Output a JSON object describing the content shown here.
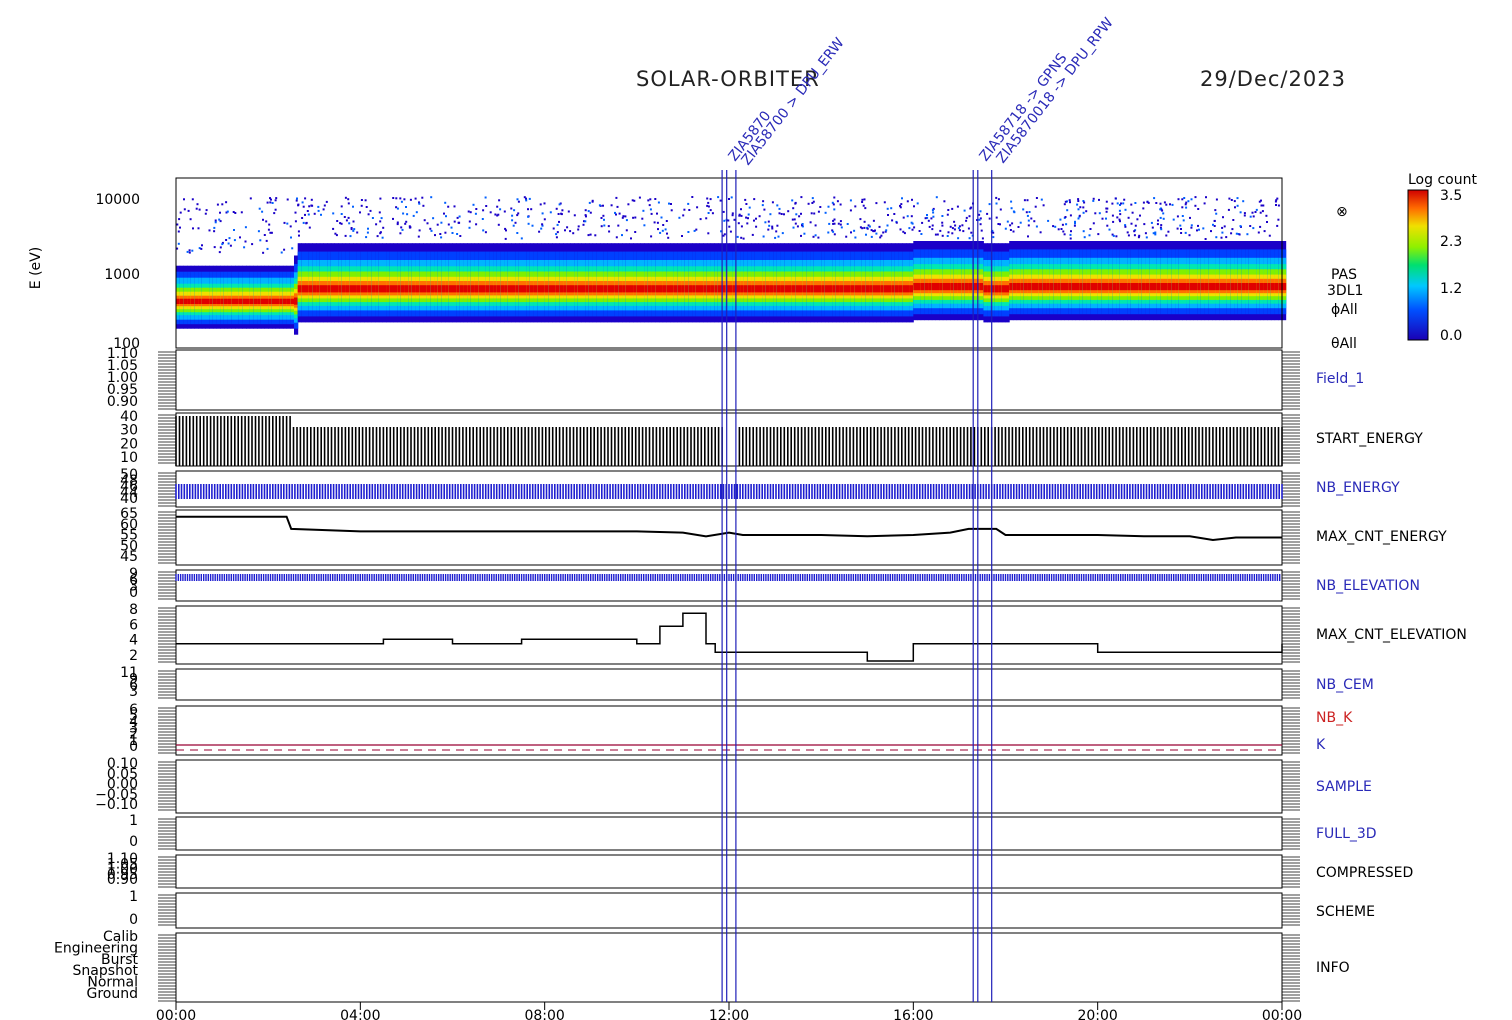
{
  "title": "SOLAR-ORBITER",
  "date": "29/Dec/2023",
  "colorbar": {
    "title": "Log count",
    "ticks": [
      "3.5",
      "2.3",
      "1.2",
      "0.0"
    ]
  },
  "spectrogram": {
    "ylabel": "E (eV)",
    "yticks": [
      "10000",
      "1000",
      "100"
    ],
    "labels": [
      "PAS",
      "3DL1",
      "ϕAll",
      "θAll"
    ],
    "symbol": "⊗"
  },
  "x_ticks": [
    "00:00",
    "04:00",
    "08:00",
    "12:00",
    "16:00",
    "20:00",
    "00:00"
  ],
  "event_labels": [
    "ZIA5870",
    "ZIA58700 > DPU_ERW",
    "ZIA58718 -> GPNS",
    "ZIA5870018 -> DPU_RPW"
  ],
  "colors": {
    "blue_line": "#1f1fb8",
    "blue_text": "#2a2ab8",
    "red_text": "#cc2222",
    "k_line": "#990033"
  },
  "panels": [
    {
      "name": "Field_1",
      "color": "blue",
      "ticks": [
        "1.10",
        "1.05",
        "1.00",
        "0.95",
        "0.90"
      ]
    },
    {
      "name": "START_ENERGY",
      "color": "black",
      "ticks": [
        "40",
        "30",
        "20",
        "10"
      ]
    },
    {
      "name": "NB_ENERGY",
      "color": "blue",
      "ticks": [
        "50",
        "48",
        "46",
        "44",
        "40"
      ]
    },
    {
      "name": "MAX_CNT_ENERGY",
      "color": "black",
      "ticks": [
        "65",
        "60",
        "55",
        "50",
        "45"
      ]
    },
    {
      "name": "NB_ELEVATION",
      "color": "blue",
      "ticks": [
        "9",
        "6",
        "3",
        "0"
      ]
    },
    {
      "name": "MAX_CNT_ELEVATION",
      "color": "black",
      "ticks": [
        "8",
        "6",
        "4",
        "2"
      ]
    },
    {
      "name": "NB_CEM",
      "color": "blue",
      "ticks": [
        "11",
        "9",
        "6",
        "3"
      ]
    },
    {
      "name": "NB_K",
      "name2": "K",
      "color": "red",
      "ticks": [
        "6",
        "5",
        "4",
        "3",
        "2",
        "1",
        "0"
      ]
    },
    {
      "name": "SAMPLE",
      "color": "blue",
      "ticks": [
        "0.10",
        "0.05",
        "0.00",
        "−0.05",
        "−0.10"
      ]
    },
    {
      "name": "FULL_3D",
      "color": "blue",
      "ticks": [
        "1",
        "0"
      ]
    },
    {
      "name": "COMPRESSED",
      "color": "black",
      "ticks": [
        "1.10",
        "1.05",
        "1.00",
        "0.95",
        "0.90"
      ]
    },
    {
      "name": "SCHEME",
      "color": "black",
      "ticks": [
        "1",
        "0"
      ]
    },
    {
      "name": "INFO",
      "color": "black",
      "ticks": [
        "Calib",
        "Engineering",
        "Burst",
        "Snapshot",
        "Normal",
        "Ground"
      ]
    }
  ],
  "chart_data": {
    "type": "line",
    "x_unit": "hours",
    "xlim": [
      0,
      24
    ],
    "event_times": [
      11.85,
      11.95,
      12.15,
      17.3,
      17.4,
      17.7
    ],
    "max_cnt_energy": {
      "x": [
        0,
        1,
        2,
        2.4,
        2.5,
        4,
        6,
        8,
        9,
        10,
        11,
        11.5,
        12,
        12.3,
        13,
        14,
        15,
        16,
        16.8,
        17.2,
        17.8,
        18,
        19,
        20,
        21,
        22,
        22.5,
        23,
        24
      ],
      "y": [
        63.5,
        63.5,
        63.5,
        63.5,
        58.5,
        57.5,
        57.5,
        57.5,
        57.5,
        57.5,
        57,
        55.5,
        57,
        56,
        56,
        56,
        55.5,
        56,
        57,
        58.5,
        58.5,
        56,
        56,
        56,
        55.5,
        55.5,
        54,
        55,
        55
      ]
    },
    "start_energy": {
      "x": [
        0,
        2.5,
        2.6,
        24
      ],
      "y": [
        40,
        40,
        33,
        33
      ]
    },
    "nb_energy": {
      "x": [
        0,
        24
      ],
      "y": [
        46,
        46
      ]
    },
    "nb_elevation": {
      "x": [
        0,
        24
      ],
      "y": [
        8,
        8
      ]
    },
    "max_cnt_elevation": {
      "x": [
        0,
        1.4,
        1.5,
        2.2,
        4.5,
        6,
        7.5,
        9,
        10,
        10.5,
        11,
        11.5,
        11.7,
        12,
        13,
        14,
        15,
        16,
        17,
        18,
        19,
        20,
        21,
        22,
        23,
        24
      ],
      "y": [
        4,
        4,
        4,
        4,
        4.5,
        4,
        4.5,
        4.5,
        4,
        6,
        7.5,
        4,
        3,
        3,
        3,
        3,
        2,
        4,
        4,
        4,
        4,
        3,
        3,
        3,
        3,
        4
      ]
    },
    "k_value": 1,
    "spectrogram_peak_energy_ev": {
      "x": [
        0,
        2.5,
        2.6,
        12,
        16,
        17.5,
        18,
        24
      ],
      "y": [
        380,
        380,
        560,
        560,
        600,
        560,
        600,
        560
      ]
    }
  }
}
